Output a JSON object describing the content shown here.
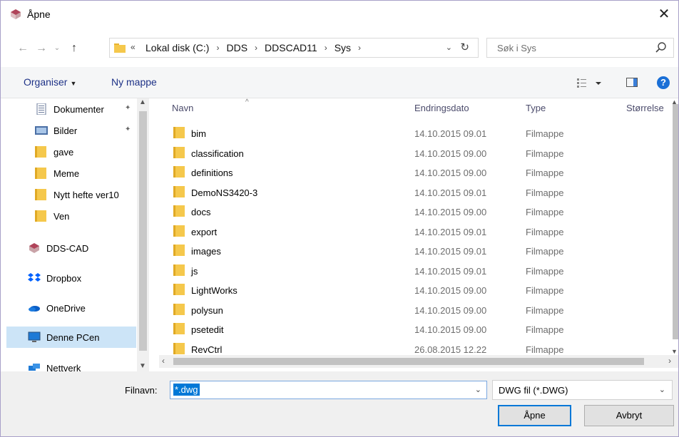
{
  "window": {
    "title": "Åpne",
    "close_glyph": "✕"
  },
  "nav": {
    "back_glyph": "←",
    "forward_glyph": "→",
    "recent_glyph": "⌄",
    "up_glyph": "↑",
    "address_overflow": "«",
    "breadcrumbs": [
      "Lokal disk (C:)",
      "DDS",
      "DDSCAD11",
      "Sys"
    ],
    "crumb_separator": "›",
    "address_dropdown_glyph": "⌄",
    "refresh_glyph": "↻",
    "search_placeholder": "Søk i Sys"
  },
  "toolbar": {
    "organise_label": "Organiser",
    "organise_caret": "▼",
    "new_folder_label": "Ny mappe",
    "help_glyph": "?"
  },
  "sidebar": {
    "items": [
      {
        "label": "Dokumenter",
        "icon": "documents-icon",
        "pinned": true
      },
      {
        "label": "Bilder",
        "icon": "pictures-icon",
        "pinned": true
      },
      {
        "label": "gave",
        "icon": "folder-icon"
      },
      {
        "label": "Meme",
        "icon": "folder-icon"
      },
      {
        "label": "Nytt hefte ver10",
        "icon": "folder-icon"
      },
      {
        "label": "Ven",
        "icon": "folder-icon"
      },
      {
        "label": "DDS-CAD",
        "icon": "dds-cad-icon"
      },
      {
        "label": "Dropbox",
        "icon": "dropbox-icon"
      },
      {
        "label": "OneDrive",
        "icon": "onedrive-icon"
      },
      {
        "label": "Denne PCen",
        "icon": "this-pc-icon",
        "selected": true
      },
      {
        "label": "Nettverk",
        "icon": "network-icon"
      }
    ],
    "pin_glyph": "✦"
  },
  "filelist": {
    "columns": [
      "Navn",
      "Endringsdato",
      "Type",
      "Størrelse"
    ],
    "sort_glyph": "^",
    "rows": [
      {
        "name": "bim",
        "date": "14.10.2015 09.01",
        "type": "Filmappe"
      },
      {
        "name": "classification",
        "date": "14.10.2015 09.00",
        "type": "Filmappe"
      },
      {
        "name": "definitions",
        "date": "14.10.2015 09.00",
        "type": "Filmappe"
      },
      {
        "name": "DemoNS3420-3",
        "date": "14.10.2015 09.01",
        "type": "Filmappe"
      },
      {
        "name": "docs",
        "date": "14.10.2015 09.00",
        "type": "Filmappe"
      },
      {
        "name": "export",
        "date": "14.10.2015 09.01",
        "type": "Filmappe"
      },
      {
        "name": "images",
        "date": "14.10.2015 09.01",
        "type": "Filmappe"
      },
      {
        "name": "js",
        "date": "14.10.2015 09.01",
        "type": "Filmappe"
      },
      {
        "name": "LightWorks",
        "date": "14.10.2015 09.00",
        "type": "Filmappe"
      },
      {
        "name": "polysun",
        "date": "14.10.2015 09.00",
        "type": "Filmappe"
      },
      {
        "name": "psetedit",
        "date": "14.10.2015 09.00",
        "type": "Filmappe"
      },
      {
        "name": "RevCtrl",
        "date": "26.08.2015 12.22",
        "type": "Filmappe"
      }
    ]
  },
  "bottom": {
    "filename_label": "Filnavn:",
    "filename_value": "*.dwg",
    "filter_value": "DWG fil (*.DWG)",
    "dropdown_glyph": "⌄",
    "open_label": "Åpne",
    "cancel_label": "Avbryt"
  },
  "colors": {
    "accent": "#0078d7",
    "folder": "#f5c84c",
    "selected_bg": "#cce4f7",
    "link": "#1e3287"
  }
}
